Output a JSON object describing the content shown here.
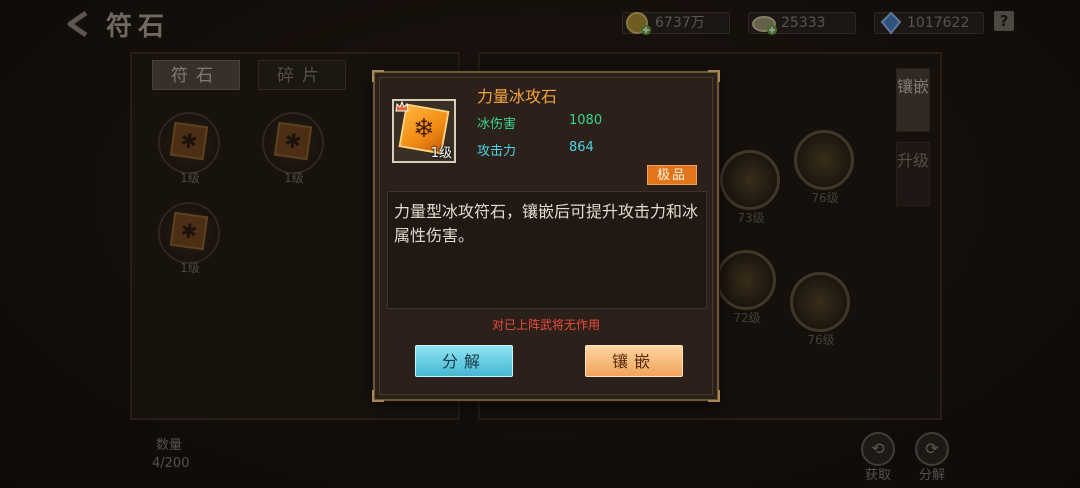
{
  "header": {
    "title": "符石",
    "currencies": [
      {
        "icon": "gold-coin-icon",
        "value": "6737万"
      },
      {
        "icon": "silver-coin-icon",
        "value": "25333"
      },
      {
        "icon": "gem-icon",
        "value": "1017622"
      }
    ],
    "help": "?"
  },
  "left_panel": {
    "tabs": [
      "符石",
      "碎片"
    ],
    "active_tab": "符石",
    "runes": [
      {
        "level": "1级"
      },
      {
        "level": "1级"
      },
      {
        "level": "1级"
      }
    ]
  },
  "right_panel": {
    "side_tabs": [
      "镶嵌",
      "升级"
    ],
    "active_side_tab": "镶嵌",
    "slots": [
      {
        "level": "73级"
      },
      {
        "level": "76级"
      },
      {
        "level": "72级"
      },
      {
        "level": "76级"
      }
    ]
  },
  "footer": {
    "count_label": "数量",
    "count_value": "4/200",
    "buttons": [
      "获取",
      "分解"
    ]
  },
  "modal": {
    "item_name": "力量冰攻石",
    "item_level": "1级",
    "stats": [
      {
        "name": "冰伤害",
        "value": "1080"
      },
      {
        "name": "攻击力",
        "value": "864"
      }
    ],
    "quality": "极品",
    "description": "力量型冰攻符石，镶嵌后可提升攻击力和冰属性伤害。",
    "warning": "对已上阵武将无作用",
    "decompose_label": "分解",
    "inlay_label": "镶嵌"
  },
  "colors": {
    "item_name": "#f4a23a",
    "stat_green": "#39d48a",
    "stat_cyan": "#4fd3e6",
    "quality_badge": "#e2751c",
    "warning": "#f04a3a"
  }
}
